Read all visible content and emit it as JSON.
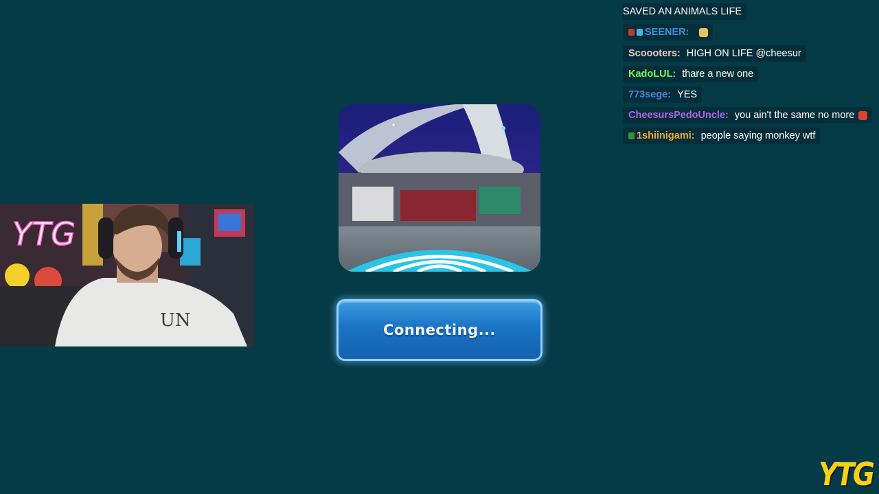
{
  "chat": {
    "messages": [
      {
        "user": "",
        "message": "SAVED AN ANIMALS LIFE",
        "user_color": "#ffffff",
        "badges": [],
        "emote": ""
      },
      {
        "user": "SEENER:",
        "message": "",
        "user_color": "#3a8fe0",
        "badges": [
          "red-badge",
          "blue-gem-badge"
        ],
        "emote": "cheese-emote"
      },
      {
        "user": "Scoooters:",
        "message": "HIGH ON LIFE @cheesur",
        "user_color": "#f2c4c9",
        "badges": [],
        "emote": ""
      },
      {
        "user": "KadoLUL:",
        "message": "thare a new one",
        "user_color": "#7cf05a",
        "badges": [],
        "emote": ""
      },
      {
        "user": "773sege:",
        "message": "YES",
        "user_color": "#4f7fd6",
        "badges": [],
        "emote": ""
      },
      {
        "user": "CheesursPedoUncle:",
        "message": "you ain't the same no more",
        "user_color": "#b266e8",
        "badges": [],
        "emote": "fries-emote"
      },
      {
        "user": "1shiinigami:",
        "message": "people saying monkey wtf",
        "user_color": "#f0a830",
        "badges": [
          "ytg-badge"
        ],
        "emote": ""
      }
    ]
  },
  "webcam": {
    "neon_sign": "YTG",
    "shirt_logo": "UN"
  },
  "game": {
    "connecting_label": "Connecting...",
    "accent": "#1a73c4"
  },
  "logo": {
    "text": "YTG",
    "color": "#f6d11a"
  }
}
